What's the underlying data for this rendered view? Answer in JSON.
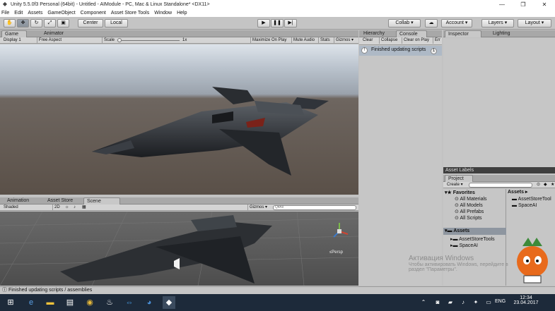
{
  "window": {
    "title": "Unity 5.5.0f3 Personal (64bit) - Untitled - AIModule - PC, Mac & Linux Standalone* <DX11>",
    "min": "—",
    "max": "❐",
    "close": "✕"
  },
  "menu": [
    "File",
    "Edit",
    "Assets",
    "GameObject",
    "Component",
    "Asset Store Tools",
    "Window",
    "Help"
  ],
  "toolbar": {
    "center": "Center",
    "local": "Local",
    "collab": "Collab ▾",
    "account": "Account ▾",
    "layers": "Layers ▾",
    "layout": "Layout ▾"
  },
  "game": {
    "tab_game": "Game",
    "tab_animator": "Animator",
    "display": "Display 1",
    "aspect": "Free Aspect",
    "scale_label": "Scale",
    "scale_value": "1x",
    "maximize": "Maximize On Play",
    "mute": "Mute Audio",
    "stats": "Stats",
    "gizmos": "Gizmos ▾"
  },
  "scene": {
    "tab_animation": "Animation",
    "tab_asset_store": "Asset Store",
    "tab_scene": "Scene",
    "shading": "Shaded",
    "mode2d": "2D",
    "gizmos": "Gizmos ▾",
    "search_placeholder": "Q▾All",
    "persp": "≤Persp"
  },
  "console": {
    "tab_hierarchy": "Hierarchy",
    "tab_console": "Console",
    "clear": "Clear",
    "collapse": "Collapse",
    "clear_on_play": "Clear on Play",
    "error_pause": "Err",
    "message": "Finished updating scripts",
    "count": "1"
  },
  "inspector": {
    "tab_inspector": "Inspector",
    "tab_lighting": "Lighting"
  },
  "asset_labels": "Asset Labels",
  "project": {
    "tab": "Project",
    "create": "Create ▾",
    "favorites": "Favorites",
    "fav_items": [
      "All Materials",
      "All Models",
      "All Prefabs",
      "All Scripts"
    ],
    "assets_root": "Assets",
    "tree_items": [
      "AssetStoreTools",
      "SpaceAI"
    ],
    "breadcrumb": "Assets ▸",
    "grid_items": [
      "AssetStoreTool",
      "SpaceAI"
    ]
  },
  "status": {
    "message": "Finished updating scripts / assemblies"
  },
  "watermark": {
    "line1": "Активация Windows",
    "line2": "Чтобы активировать Windows, перейдите в",
    "line3": "раздел \"Параметры\"."
  },
  "taskbar": {
    "lang": "ENG",
    "time": "12:34",
    "date": "23.04.2017"
  }
}
